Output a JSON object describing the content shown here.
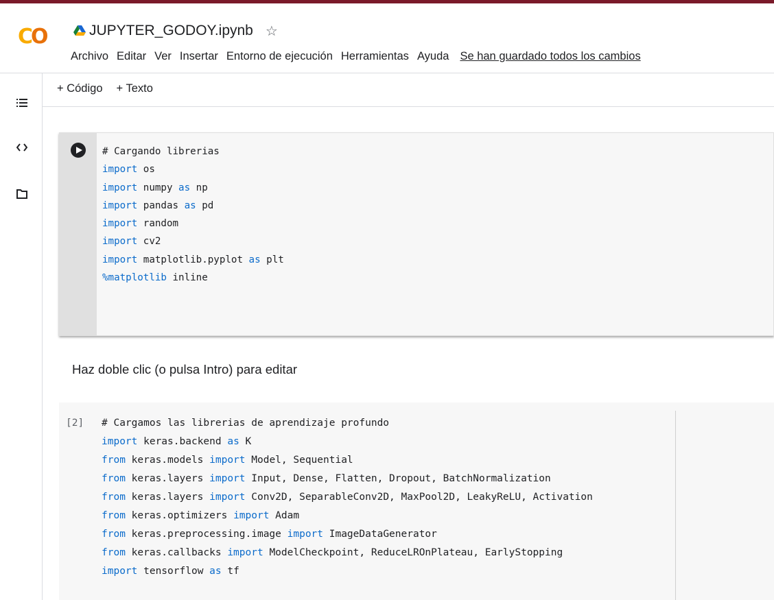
{
  "colors": {
    "top_strip": "#7a1a2a",
    "logo_yellow": "#f9ab00",
    "logo_orange": "#e8710a",
    "keyword": "#0b6bcb",
    "cell_bg": "#f7f7f7",
    "gutter": "#e0e0e0"
  },
  "app": {
    "logo_text_c": "C",
    "logo_text_o": "O",
    "file_name": "JUPYTER_GODOY.ipynb",
    "star_icon": "☆"
  },
  "menu": {
    "items": [
      "Archivo",
      "Editar",
      "Ver",
      "Insertar",
      "Entorno de ejecución",
      "Herramientas",
      "Ayuda"
    ],
    "saved_status": "Se han guardado todos los cambios"
  },
  "sidebar": {
    "icons": [
      "toc-icon",
      "code-snippets-icon",
      "files-icon"
    ]
  },
  "toolbar": {
    "add_code": "+ Código",
    "add_text": "+ Texto"
  },
  "cells": [
    {
      "type": "code",
      "execution_count": "",
      "lines": [
        [
          [
            "cm",
            "# Cargando librerias"
          ]
        ],
        [
          [
            "kw",
            "import"
          ],
          [
            "",
            " os"
          ]
        ],
        [
          [
            "kw",
            "import"
          ],
          [
            "",
            " numpy "
          ],
          [
            "kw",
            "as"
          ],
          [
            "",
            " np"
          ]
        ],
        [
          [
            "kw",
            "import"
          ],
          [
            "",
            " pandas "
          ],
          [
            "kw",
            "as"
          ],
          [
            "",
            " pd"
          ]
        ],
        [
          [
            "kw",
            "import"
          ],
          [
            "",
            " random"
          ]
        ],
        [
          [
            "kw",
            "import"
          ],
          [
            "",
            " cv2"
          ]
        ],
        [
          [
            "kw",
            "import"
          ],
          [
            "",
            " matplotlib.pyplot "
          ],
          [
            "kw",
            "as"
          ],
          [
            "",
            " plt"
          ]
        ],
        [
          [
            "kw",
            "%matplotlib"
          ],
          [
            "",
            " inline"
          ]
        ]
      ]
    },
    {
      "type": "text",
      "placeholder": "Haz doble clic (o pulsa Intro) para editar"
    },
    {
      "type": "code",
      "execution_count": "[2]",
      "lines": [
        [
          [
            "cm",
            "# Cargamos las librerias de aprendizaje profundo"
          ]
        ],
        [
          [
            "kw",
            "import"
          ],
          [
            "",
            " keras.backend "
          ],
          [
            "kw",
            "as"
          ],
          [
            "",
            " K"
          ]
        ],
        [
          [
            "kw",
            "from"
          ],
          [
            "",
            " keras.models "
          ],
          [
            "kw",
            "import"
          ],
          [
            "",
            " Model, Sequential"
          ]
        ],
        [
          [
            "kw",
            "from"
          ],
          [
            "",
            " keras.layers "
          ],
          [
            "kw",
            "import"
          ],
          [
            "",
            " Input, Dense, Flatten, Dropout, BatchNormalization"
          ]
        ],
        [
          [
            "kw",
            "from"
          ],
          [
            "",
            " keras.layers "
          ],
          [
            "kw",
            "import"
          ],
          [
            "",
            " Conv2D, SeparableConv2D, MaxPool2D, LeakyReLU, Activation"
          ]
        ],
        [
          [
            "kw",
            "from"
          ],
          [
            "",
            " keras.optimizers "
          ],
          [
            "kw",
            "import"
          ],
          [
            "",
            " Adam"
          ]
        ],
        [
          [
            "kw",
            "from"
          ],
          [
            "",
            " keras.preprocessing.image "
          ],
          [
            "kw",
            "import"
          ],
          [
            "",
            " ImageDataGenerator"
          ]
        ],
        [
          [
            "kw",
            "from"
          ],
          [
            "",
            " keras.callbacks "
          ],
          [
            "kw",
            "import"
          ],
          [
            "",
            " ModelCheckpoint, ReduceLROnPlateau, EarlyStopping"
          ]
        ],
        [
          [
            "kw",
            "import"
          ],
          [
            "",
            " tensorflow "
          ],
          [
            "kw",
            "as"
          ],
          [
            "",
            " tf"
          ]
        ]
      ]
    }
  ]
}
